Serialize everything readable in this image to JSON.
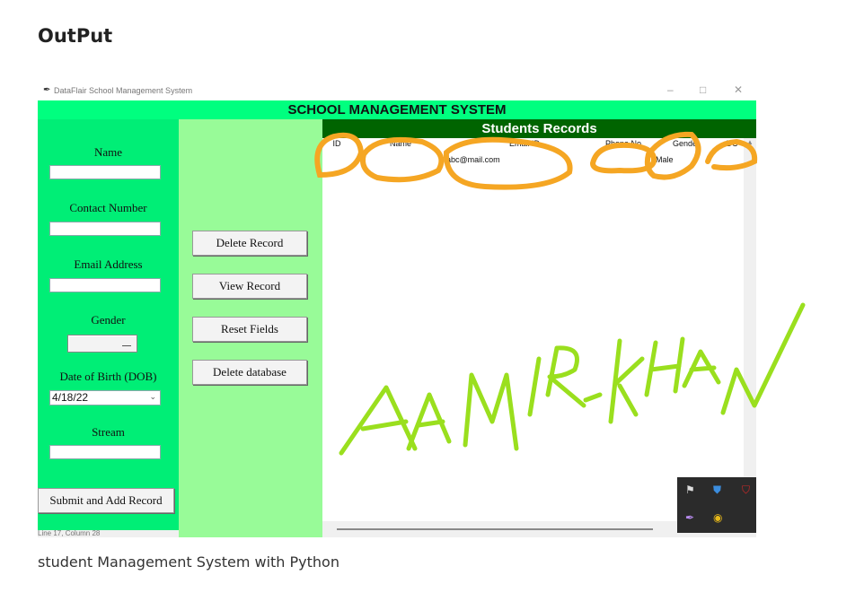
{
  "page": {
    "heading": "OutPut",
    "caption": "student Management System with Python"
  },
  "window": {
    "title": "DataFlair School Management System",
    "controls": [
      "–",
      "□",
      "✕"
    ],
    "app_title": "SCHOOL MANAGEMENT SYSTEM",
    "status_text": "Line 17, Column 28"
  },
  "form": {
    "name_label": "Name",
    "contact_label": "Contact Number",
    "email_label": "Email Address",
    "gender_label": "Gender",
    "dob_label": "Date of Birth (DOB)",
    "dob_value": "4/18/22",
    "stream_label": "Stream",
    "submit_label": "Submit and Add Record"
  },
  "actions": {
    "delete_record": "Delete Record",
    "view_record": "View Record",
    "reset_fields": "Reset Fields",
    "delete_database": "Delete database"
  },
  "records": {
    "title": "Students Records",
    "columns": [
      "ID",
      "Name",
      "Email ID",
      "Phone No",
      "Gender",
      "DC"
    ],
    "rows": [
      {
        "email": "abc@mail.com",
        "gender": "Male"
      }
    ]
  },
  "annotation": {
    "text": "AAMIR-KHAN",
    "circle_color": "#f5a623",
    "signature_color": "#9adf1e"
  },
  "taskbar_icons": [
    "notification-icon",
    "defender-icon",
    "mcafee-icon",
    "pen-icon",
    "chrome-icon"
  ]
}
